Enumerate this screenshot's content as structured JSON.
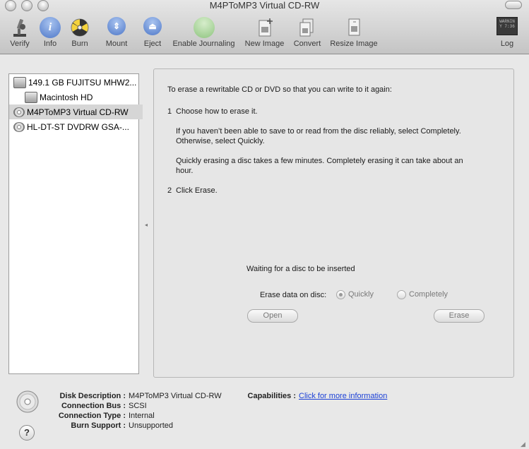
{
  "window": {
    "title": "M4PToMP3 Virtual CD-RW"
  },
  "toolbar": {
    "verify": "Verify",
    "info": "Info",
    "burn": "Burn",
    "mount": "Mount",
    "eject": "Eject",
    "enable_journaling": "Enable Journaling",
    "new_image": "New Image",
    "convert": "Convert",
    "resize_image": "Resize Image",
    "log": "Log",
    "log_icon_text": "WARNIN\nY 7:36"
  },
  "sidebar": {
    "items": [
      {
        "label": "149.1 GB FUJITSU MHW2...",
        "icon": "hard-disk-icon"
      },
      {
        "label": "Macintosh HD",
        "icon": "volume-icon"
      },
      {
        "label": "M4PToMP3 Virtual CD-RW",
        "icon": "optical-disc-icon",
        "selected": true
      },
      {
        "label": "HL-DT-ST DVDRW GSA-...",
        "icon": "optical-disc-icon"
      }
    ]
  },
  "erase_panel": {
    "intro": "To erase a rewritable CD or DVD so that you can write to it again:",
    "step1_num": "1",
    "step1": "Choose how to erase it.",
    "para1_line1": "If you haven’t been able to save to or read from the disc reliably, select Completely.",
    "para1_line2": "Otherwise, select Quickly.",
    "para2_line1": "Quickly erasing a disc takes a few minutes. Completely erasing it can take about an",
    "para2_line2": "hour.",
    "step2_num": "2",
    "step2": "Click Erase.",
    "status": "Waiting for a disc to be inserted",
    "erase_label": "Erase data on disc:",
    "quickly": "Quickly",
    "completely": "Completely",
    "selected_option": "Quickly",
    "open_button": "Open",
    "erase_button": "Erase"
  },
  "info": {
    "disk_description_label": "Disk Description :",
    "disk_description": "M4PToMP3 Virtual CD-RW",
    "connection_bus_label": "Connection Bus :",
    "connection_bus": "SCSI",
    "connection_type_label": "Connection Type :",
    "connection_type": "Internal",
    "burn_support_label": "Burn Support :",
    "burn_support": "Unsupported",
    "capabilities_label": "Capabilities :",
    "capabilities_link": "Click for more information",
    "help": "?"
  },
  "colors": {
    "link": "#1a3fd6",
    "selection": "#d6d6d6",
    "info_blue": "#5a86d6",
    "green": "#6ac26a"
  }
}
